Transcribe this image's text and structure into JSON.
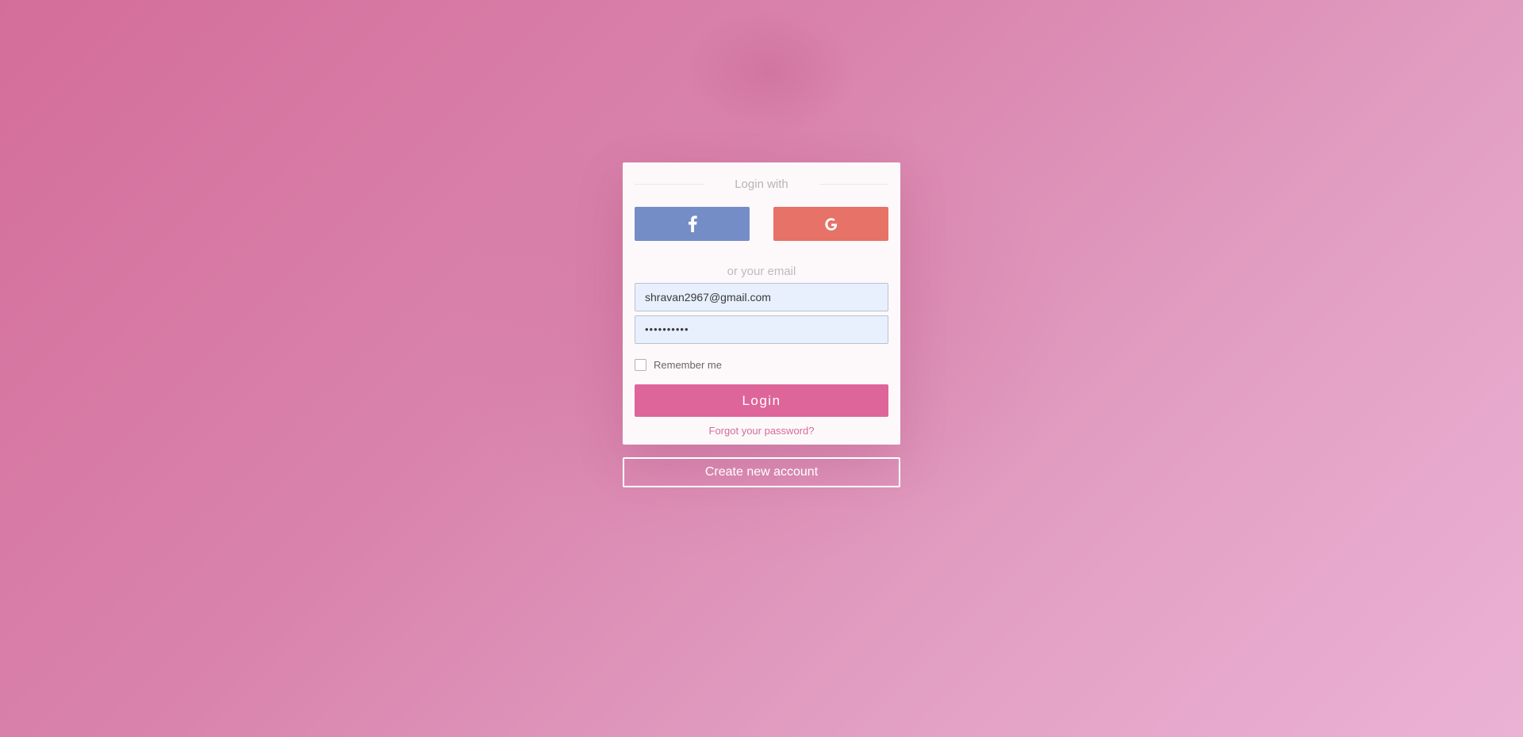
{
  "login": {
    "login_with": "Login with",
    "or_email": "or your email",
    "email_value": "shravan2967@gmail.com",
    "password_value": "••••••••••",
    "remember_label": "Remember me",
    "remember_checked": false,
    "login_label": "Login",
    "forgot_label": "Forgot your password?"
  },
  "social": {
    "facebook_icon": "facebook-icon",
    "google_icon": "google-icon"
  },
  "footer": {
    "create_account_label": "Create new account"
  },
  "colors": {
    "facebook": "#758dc6",
    "google": "#e77268",
    "primary": "#dd6599",
    "link": "#d56b97",
    "card": "#fdf9fb",
    "input_bg": "#e8f0fd"
  }
}
